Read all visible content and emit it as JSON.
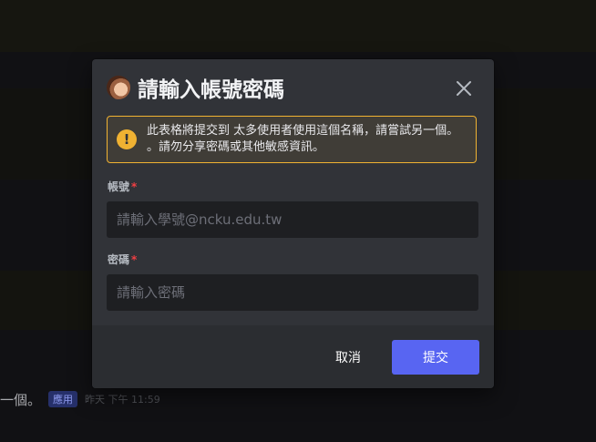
{
  "background": {
    "message_fragment": "一個。",
    "app_badge": "應用",
    "timestamp": "昨天 下午 11:59"
  },
  "modal": {
    "title": "請輸入帳號密碼",
    "icon": "app-avatar",
    "close_icon": "close-icon",
    "warning": {
      "icon": "exclamation",
      "text": "此表格將提交到 太多使用者使用這個名稱，請嘗試另一個。 。請勿分享密碼或其他敏感資訊。",
      "color": "#f0b232"
    },
    "fields": [
      {
        "label": "帳號",
        "required_marker": "*",
        "value": "",
        "placeholder": "請輸入學號@ncku.edu.tw"
      },
      {
        "label": "密碼",
        "required_marker": "*",
        "value": "",
        "placeholder": "請輸入密碼"
      }
    ],
    "buttons": {
      "cancel": "取消",
      "submit": "提交"
    }
  },
  "colors": {
    "accent": "#5865f2",
    "required": "#f23f43",
    "warning": "#f0b232"
  }
}
